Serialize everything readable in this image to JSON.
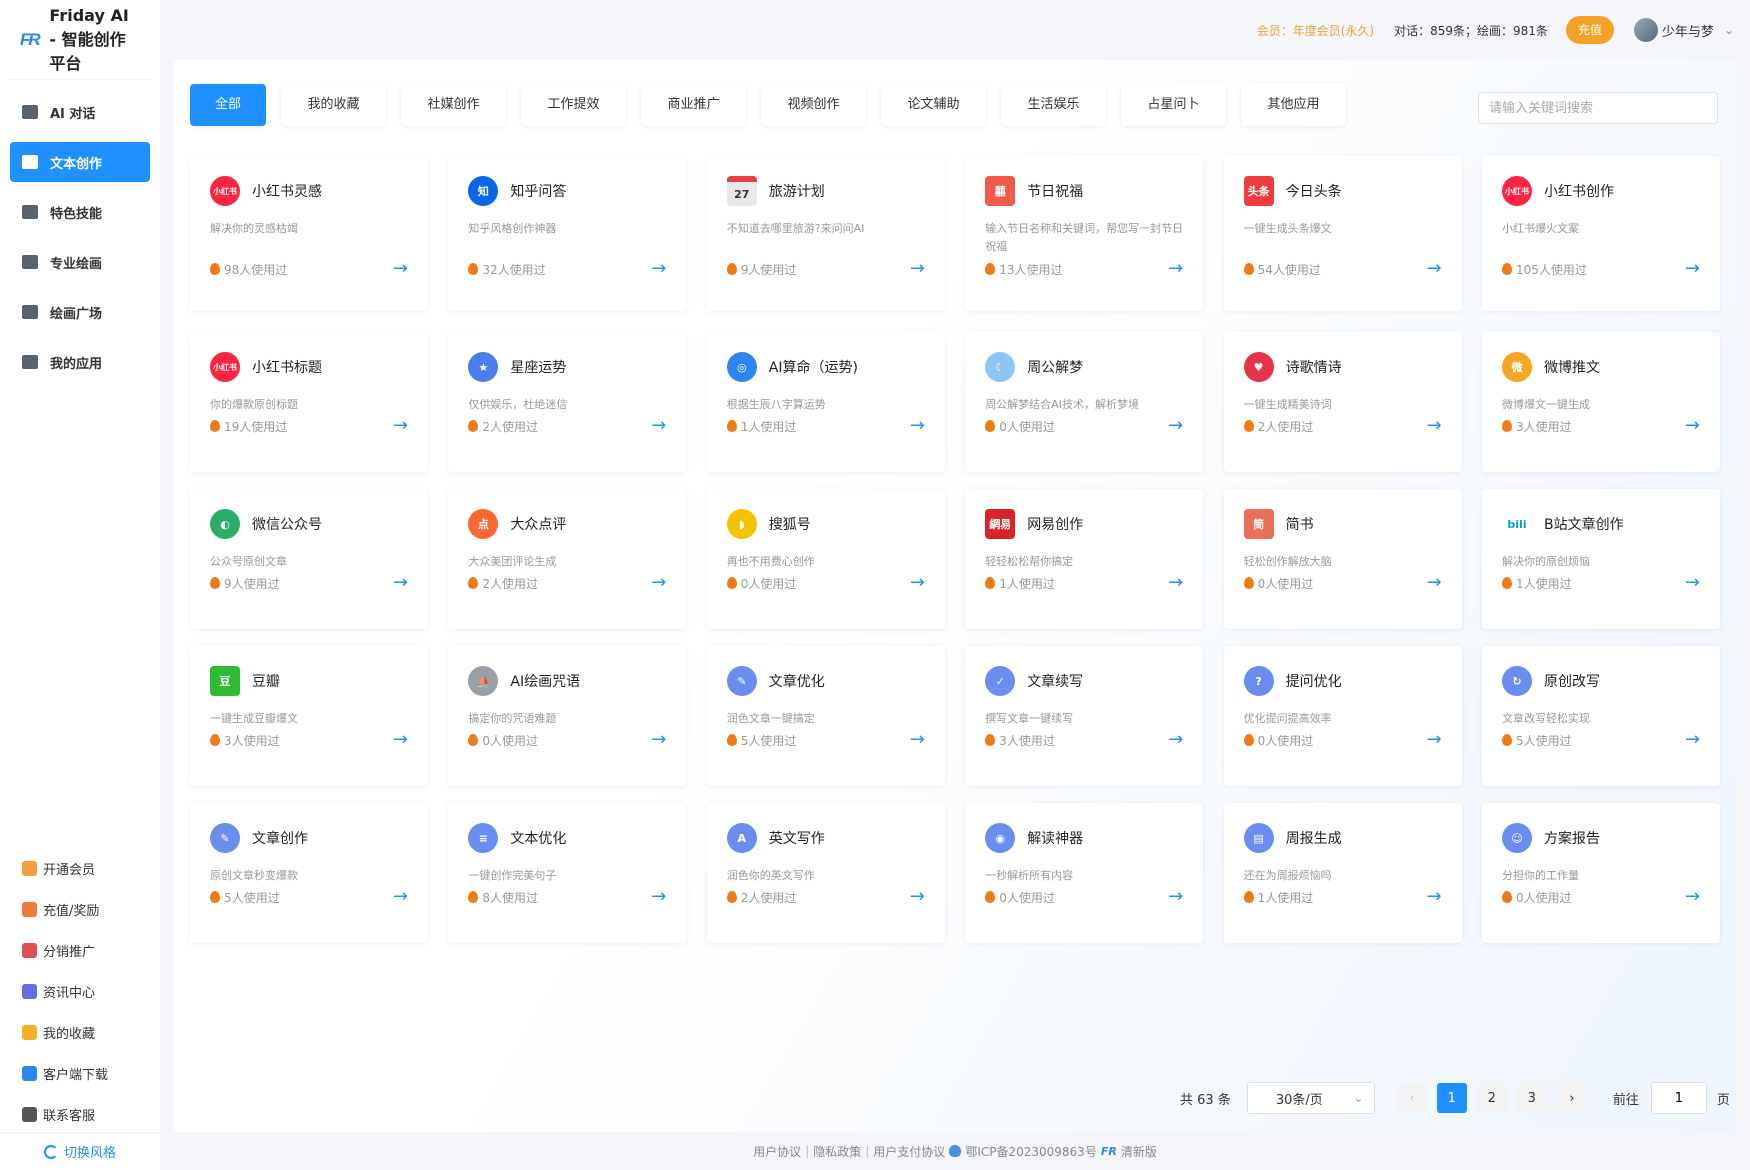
{
  "brand": {
    "logo": "FR",
    "title": "Friday AI - 智能创作平台"
  },
  "nav": [
    {
      "label": "AI 对话",
      "icon": "chat-icon",
      "active": false
    },
    {
      "label": "文本创作",
      "icon": "pencil-icon",
      "active": true
    },
    {
      "label": "特色技能",
      "icon": "list-icon",
      "active": false
    },
    {
      "label": "专业绘画",
      "icon": "palette-icon",
      "active": false
    },
    {
      "label": "绘画广场",
      "icon": "image-icon",
      "active": false
    },
    {
      "label": "我的应用",
      "icon": "apps-icon",
      "active": false
    }
  ],
  "bottom_nav": [
    {
      "label": "开通会员",
      "icon": "diamond-icon",
      "color": "#f0a040"
    },
    {
      "label": "充值/奖励",
      "icon": "coin-icon",
      "color": "#f07a3a"
    },
    {
      "label": "分销推广",
      "icon": "network-icon",
      "color": "#e05050"
    },
    {
      "label": "资讯中心",
      "icon": "news-icon",
      "color": "#6a6ae8"
    },
    {
      "label": "我的收藏",
      "icon": "star-icon",
      "color": "#f5b023"
    },
    {
      "label": "客户端下载",
      "icon": "windows-icon",
      "color": "#2c86f1"
    },
    {
      "label": "联系客服",
      "icon": "headset-icon",
      "color": "#555555"
    }
  ],
  "switch_style": "切换风格",
  "topbar": {
    "member": "会员：年度会员(永久)",
    "quota": "对话：859条；绘画：981条",
    "recharge": "充值",
    "username": "少年与梦"
  },
  "tabs": [
    "全部",
    "我的收藏",
    "社媒创作",
    "工作提效",
    "商业推广",
    "视频创作",
    "论文辅助",
    "生活娱乐",
    "占星问卜",
    "其他应用"
  ],
  "search": {
    "placeholder": "请输入关键词搜索"
  },
  "cards": [
    {
      "title": "小红书灵感",
      "desc": "解决你的灵感枯竭",
      "uses": "98人使用过",
      "icon": "xiaohongshu-icon",
      "icon_text": "小红书",
      "color": "#ff2442"
    },
    {
      "title": "知乎问答",
      "desc": "知乎风格创作神器",
      "uses": "32人使用过",
      "icon": "zhihu-icon",
      "icon_text": "知",
      "color": "#0a66e8"
    },
    {
      "title": "旅游计划",
      "desc": "不知道去哪里旅游?来问问AI",
      "uses": "9人使用过",
      "icon": "calendar-icon",
      "icon_text": "27",
      "color": "#e8e8e8"
    },
    {
      "title": "节日祝福",
      "desc": "输入节日名称和关键词，帮您写一封节日祝福",
      "uses": "13人使用过",
      "icon": "gift-icon",
      "icon_text": "囍",
      "color": "#f05a4a"
    },
    {
      "title": "今日头条",
      "desc": "一键生成头条爆文",
      "uses": "54人使用过",
      "icon": "toutiao-icon",
      "icon_text": "头条",
      "color": "#f03c3c"
    },
    {
      "title": "小红书创作",
      "desc": "小红书爆火文案",
      "uses": "105人使用过",
      "icon": "xiaohongshu-icon",
      "icon_text": "小红书",
      "color": "#ff2442"
    },
    {
      "title": "小红书标题",
      "desc": "你的爆款原创标题",
      "uses": "19人使用过",
      "icon": "xiaohongshu-icon",
      "icon_text": "小红书",
      "color": "#ff2442"
    },
    {
      "title": "星座运势",
      "desc": "仅供娱乐，杜绝迷信",
      "uses": "2人使用过",
      "icon": "star-icon",
      "icon_text": "★",
      "color": "#4a7ef0"
    },
    {
      "title": "AI算命（运势)",
      "desc": "根据生辰八字算运势",
      "uses": "1人使用过",
      "icon": "fortune-icon",
      "icon_text": "◎",
      "color": "#2c86f1"
    },
    {
      "title": "周公解梦",
      "desc": "周公解梦结合AI技术，解析梦境",
      "uses": "0人使用过",
      "icon": "dream-icon",
      "icon_text": "☾",
      "color": "#8ec5f0"
    },
    {
      "title": "诗歌情诗",
      "desc": "一键生成精美诗词",
      "uses": "2人使用过",
      "icon": "heart-icon",
      "icon_text": "♥",
      "color": "#e8324a"
    },
    {
      "title": "微博推文",
      "desc": "微博爆文一键生成",
      "uses": "3人使用过",
      "icon": "weibo-icon",
      "icon_text": "微",
      "color": "#f5a623"
    },
    {
      "title": "微信公众号",
      "desc": "公众号原创文章",
      "uses": "9人使用过",
      "icon": "wechat-icon",
      "icon_text": "◐",
      "color": "#2aae67"
    },
    {
      "title": "大众点评",
      "desc": "大众美团评论生成",
      "uses": "2人使用过",
      "icon": "dianping-icon",
      "icon_text": "点",
      "color": "#ff6633"
    },
    {
      "title": "搜狐号",
      "desc": "再也不用费心创作",
      "uses": "0人使用过",
      "icon": "sohu-icon",
      "icon_text": "◗",
      "color": "#f5c400"
    },
    {
      "title": "网易创作",
      "desc": "轻轻松松帮你搞定",
      "uses": "1人使用过",
      "icon": "netease-icon",
      "icon_text": "網易",
      "color": "#d8232a"
    },
    {
      "title": "简书",
      "desc": "轻松创作解放大脑",
      "uses": "0人使用过",
      "icon": "jianshu-icon",
      "icon_text": "简",
      "color": "#ea6f5a"
    },
    {
      "title": "B站文章创作",
      "desc": "解决你的原创烦恼",
      "uses": "1人使用过",
      "icon": "bilibili-icon",
      "icon_text": "bili",
      "color": "#00a1d6"
    },
    {
      "title": "豆瓣",
      "desc": "一键生成豆瓣爆文",
      "uses": "3人使用过",
      "icon": "douban-icon",
      "icon_text": "豆",
      "color": "#2dbd35"
    },
    {
      "title": "AI绘画咒语",
      "desc": "搞定你的咒语难题",
      "uses": "0人使用过",
      "icon": "sailboat-icon",
      "icon_text": "⛵",
      "color": "#9aa0a8"
    },
    {
      "title": "文章优化",
      "desc": "润色文章一键搞定",
      "uses": "5人使用过",
      "icon": "document-edit-icon",
      "icon_text": "✎",
      "color": "#6a8ef0"
    },
    {
      "title": "文章续写",
      "desc": "撰写文章一键续写",
      "uses": "3人使用过",
      "icon": "document-check-icon",
      "icon_text": "✓",
      "color": "#6a8ef0"
    },
    {
      "title": "提问优化",
      "desc": "优化提问提高效率",
      "uses": "0人使用过",
      "icon": "question-icon",
      "icon_text": "?",
      "color": "#6a8ef0"
    },
    {
      "title": "原创改写",
      "desc": "文章改写轻松实现",
      "uses": "5人使用过",
      "icon": "rewrite-icon",
      "icon_text": "↻",
      "color": "#6a8ef0"
    },
    {
      "title": "文章创作",
      "desc": "原创文章秒变爆款",
      "uses": "5人使用过",
      "icon": "document-edit-icon",
      "icon_text": "✎",
      "color": "#6a8ef0"
    },
    {
      "title": "文本优化",
      "desc": "一键创作完美句子",
      "uses": "8人使用过",
      "icon": "document-icon",
      "icon_text": "≡",
      "color": "#6a8ef0"
    },
    {
      "title": "英文写作",
      "desc": "润色你的英文写作",
      "uses": "2人使用过",
      "icon": "english-icon",
      "icon_text": "A",
      "color": "#6a8ef0"
    },
    {
      "title": "解读神器",
      "desc": "一秒解析所有内容",
      "uses": "0人使用过",
      "icon": "analyze-icon",
      "icon_text": "◉",
      "color": "#6a8ef0"
    },
    {
      "title": "周报生成",
      "desc": "还在为周报烦恼吗",
      "uses": "1人使用过",
      "icon": "report-icon",
      "icon_text": "▤",
      "color": "#6a8ef0"
    },
    {
      "title": "方案报告",
      "desc": "分担你的工作量",
      "uses": "0人使用过",
      "icon": "plan-icon",
      "icon_text": "☺",
      "color": "#6a8ef0"
    }
  ],
  "pagination": {
    "total": "共 63 条",
    "page_size": "30条/页",
    "prev": "‹",
    "pages": [
      "1",
      "2",
      "3"
    ],
    "current": "1",
    "next": "›",
    "goto_label": "前往",
    "goto_value": "1",
    "goto_suffix": "页"
  },
  "footer": {
    "user_agreement": "用户协议",
    "privacy": "隐私政策",
    "payment": "用户支付协议",
    "icp": "鄂ICP备2023009863号",
    "version": "清新版",
    "sep": "|"
  }
}
